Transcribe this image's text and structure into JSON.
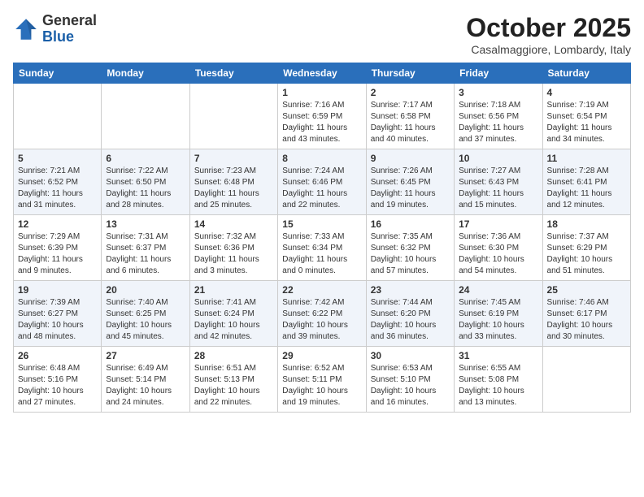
{
  "logo": {
    "general": "General",
    "blue": "Blue"
  },
  "title": {
    "month": "October 2025",
    "location": "Casalmaggiore, Lombardy, Italy"
  },
  "weekdays": [
    "Sunday",
    "Monday",
    "Tuesday",
    "Wednesday",
    "Thursday",
    "Friday",
    "Saturday"
  ],
  "weeks": [
    [
      {
        "day": null,
        "sunrise": null,
        "sunset": null,
        "daylight": null
      },
      {
        "day": null,
        "sunrise": null,
        "sunset": null,
        "daylight": null
      },
      {
        "day": null,
        "sunrise": null,
        "sunset": null,
        "daylight": null
      },
      {
        "day": "1",
        "sunrise": "Sunrise: 7:16 AM",
        "sunset": "Sunset: 6:59 PM",
        "daylight": "Daylight: 11 hours and 43 minutes."
      },
      {
        "day": "2",
        "sunrise": "Sunrise: 7:17 AM",
        "sunset": "Sunset: 6:58 PM",
        "daylight": "Daylight: 11 hours and 40 minutes."
      },
      {
        "day": "3",
        "sunrise": "Sunrise: 7:18 AM",
        "sunset": "Sunset: 6:56 PM",
        "daylight": "Daylight: 11 hours and 37 minutes."
      },
      {
        "day": "4",
        "sunrise": "Sunrise: 7:19 AM",
        "sunset": "Sunset: 6:54 PM",
        "daylight": "Daylight: 11 hours and 34 minutes."
      }
    ],
    [
      {
        "day": "5",
        "sunrise": "Sunrise: 7:21 AM",
        "sunset": "Sunset: 6:52 PM",
        "daylight": "Daylight: 11 hours and 31 minutes."
      },
      {
        "day": "6",
        "sunrise": "Sunrise: 7:22 AM",
        "sunset": "Sunset: 6:50 PM",
        "daylight": "Daylight: 11 hours and 28 minutes."
      },
      {
        "day": "7",
        "sunrise": "Sunrise: 7:23 AM",
        "sunset": "Sunset: 6:48 PM",
        "daylight": "Daylight: 11 hours and 25 minutes."
      },
      {
        "day": "8",
        "sunrise": "Sunrise: 7:24 AM",
        "sunset": "Sunset: 6:46 PM",
        "daylight": "Daylight: 11 hours and 22 minutes."
      },
      {
        "day": "9",
        "sunrise": "Sunrise: 7:26 AM",
        "sunset": "Sunset: 6:45 PM",
        "daylight": "Daylight: 11 hours and 19 minutes."
      },
      {
        "day": "10",
        "sunrise": "Sunrise: 7:27 AM",
        "sunset": "Sunset: 6:43 PM",
        "daylight": "Daylight: 11 hours and 15 minutes."
      },
      {
        "day": "11",
        "sunrise": "Sunrise: 7:28 AM",
        "sunset": "Sunset: 6:41 PM",
        "daylight": "Daylight: 11 hours and 12 minutes."
      }
    ],
    [
      {
        "day": "12",
        "sunrise": "Sunrise: 7:29 AM",
        "sunset": "Sunset: 6:39 PM",
        "daylight": "Daylight: 11 hours and 9 minutes."
      },
      {
        "day": "13",
        "sunrise": "Sunrise: 7:31 AM",
        "sunset": "Sunset: 6:37 PM",
        "daylight": "Daylight: 11 hours and 6 minutes."
      },
      {
        "day": "14",
        "sunrise": "Sunrise: 7:32 AM",
        "sunset": "Sunset: 6:36 PM",
        "daylight": "Daylight: 11 hours and 3 minutes."
      },
      {
        "day": "15",
        "sunrise": "Sunrise: 7:33 AM",
        "sunset": "Sunset: 6:34 PM",
        "daylight": "Daylight: 11 hours and 0 minutes."
      },
      {
        "day": "16",
        "sunrise": "Sunrise: 7:35 AM",
        "sunset": "Sunset: 6:32 PM",
        "daylight": "Daylight: 10 hours and 57 minutes."
      },
      {
        "day": "17",
        "sunrise": "Sunrise: 7:36 AM",
        "sunset": "Sunset: 6:30 PM",
        "daylight": "Daylight: 10 hours and 54 minutes."
      },
      {
        "day": "18",
        "sunrise": "Sunrise: 7:37 AM",
        "sunset": "Sunset: 6:29 PM",
        "daylight": "Daylight: 10 hours and 51 minutes."
      }
    ],
    [
      {
        "day": "19",
        "sunrise": "Sunrise: 7:39 AM",
        "sunset": "Sunset: 6:27 PM",
        "daylight": "Daylight: 10 hours and 48 minutes."
      },
      {
        "day": "20",
        "sunrise": "Sunrise: 7:40 AM",
        "sunset": "Sunset: 6:25 PM",
        "daylight": "Daylight: 10 hours and 45 minutes."
      },
      {
        "day": "21",
        "sunrise": "Sunrise: 7:41 AM",
        "sunset": "Sunset: 6:24 PM",
        "daylight": "Daylight: 10 hours and 42 minutes."
      },
      {
        "day": "22",
        "sunrise": "Sunrise: 7:42 AM",
        "sunset": "Sunset: 6:22 PM",
        "daylight": "Daylight: 10 hours and 39 minutes."
      },
      {
        "day": "23",
        "sunrise": "Sunrise: 7:44 AM",
        "sunset": "Sunset: 6:20 PM",
        "daylight": "Daylight: 10 hours and 36 minutes."
      },
      {
        "day": "24",
        "sunrise": "Sunrise: 7:45 AM",
        "sunset": "Sunset: 6:19 PM",
        "daylight": "Daylight: 10 hours and 33 minutes."
      },
      {
        "day": "25",
        "sunrise": "Sunrise: 7:46 AM",
        "sunset": "Sunset: 6:17 PM",
        "daylight": "Daylight: 10 hours and 30 minutes."
      }
    ],
    [
      {
        "day": "26",
        "sunrise": "Sunrise: 6:48 AM",
        "sunset": "Sunset: 5:16 PM",
        "daylight": "Daylight: 10 hours and 27 minutes."
      },
      {
        "day": "27",
        "sunrise": "Sunrise: 6:49 AM",
        "sunset": "Sunset: 5:14 PM",
        "daylight": "Daylight: 10 hours and 24 minutes."
      },
      {
        "day": "28",
        "sunrise": "Sunrise: 6:51 AM",
        "sunset": "Sunset: 5:13 PM",
        "daylight": "Daylight: 10 hours and 22 minutes."
      },
      {
        "day": "29",
        "sunrise": "Sunrise: 6:52 AM",
        "sunset": "Sunset: 5:11 PM",
        "daylight": "Daylight: 10 hours and 19 minutes."
      },
      {
        "day": "30",
        "sunrise": "Sunrise: 6:53 AM",
        "sunset": "Sunset: 5:10 PM",
        "daylight": "Daylight: 10 hours and 16 minutes."
      },
      {
        "day": "31",
        "sunrise": "Sunrise: 6:55 AM",
        "sunset": "Sunset: 5:08 PM",
        "daylight": "Daylight: 10 hours and 13 minutes."
      },
      {
        "day": null,
        "sunrise": null,
        "sunset": null,
        "daylight": null
      }
    ]
  ]
}
